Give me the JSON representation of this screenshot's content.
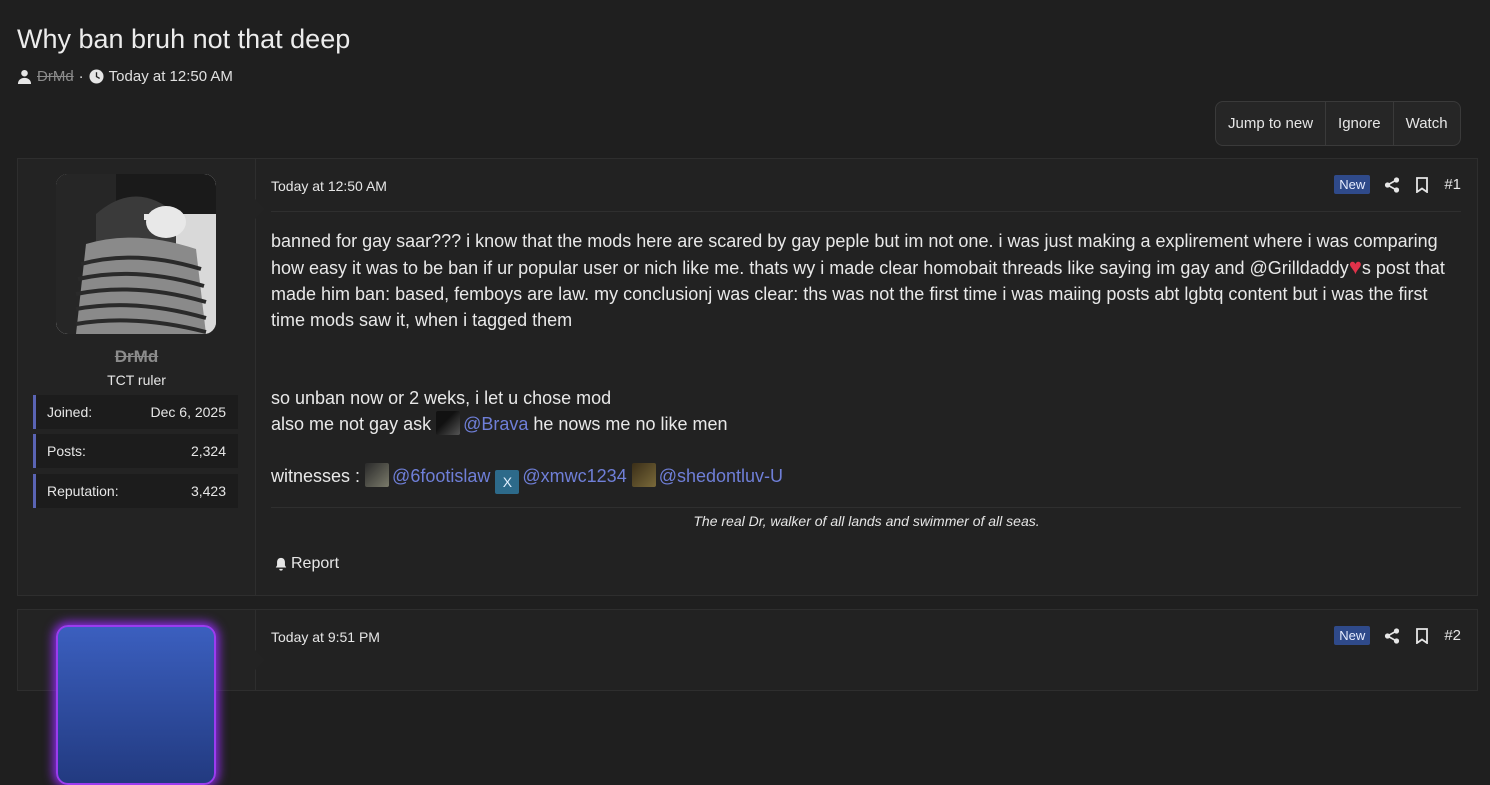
{
  "thread": {
    "title": "Why ban bruh not that deep",
    "author": "DrMd",
    "separator": "·",
    "time": "Today at 12:50 AM"
  },
  "buttons": {
    "jump_to_new": "Jump to new",
    "ignore": "Ignore",
    "watch": "Watch"
  },
  "posts": [
    {
      "username": "DrMd",
      "user_title": "TCT ruler",
      "stats": [
        {
          "label": "Joined:",
          "value": "Dec 6, 2025"
        },
        {
          "label": "Posts:",
          "value": "2,324"
        },
        {
          "label": "Reputation:",
          "value": "3,423"
        }
      ],
      "date": "Today at 12:50 AM",
      "badge": "New",
      "number": "#1",
      "para1_a": "banned for gay saar??? i know that the mods here are scared by gay peple but im not one. i was just making a explirement where i was comparing how easy it was to be ban if ur popular user or nich like me. thats wy i made clear homobait threads like saying im gay and ",
      "para1_mention": "@Grilldaddy",
      "para1_b": "s post that made him ban: based, femboys are law. my conclusionj was clear: ths was not the first time i was maiing posts abt lgbtq content but i was the first time mods saw it, when i tagged them",
      "para2": "so unban now or 2 weks, i let u chose mod",
      "para3_a": "also me not gay ask ",
      "para3_mention": "@Brava",
      "para3_b": " he nows me no like men",
      "witness_label": "witnesses : ",
      "witnesses": [
        "@6footislaw",
        "@xmwc1234",
        "@shedontluv-U"
      ],
      "x_avatar_letter": "X",
      "signature": "The real Dr, walker of all lands and swimmer of all seas.",
      "report": "Report"
    },
    {
      "date": "Today at 9:51 PM",
      "badge": "New",
      "number": "#2"
    }
  ]
}
